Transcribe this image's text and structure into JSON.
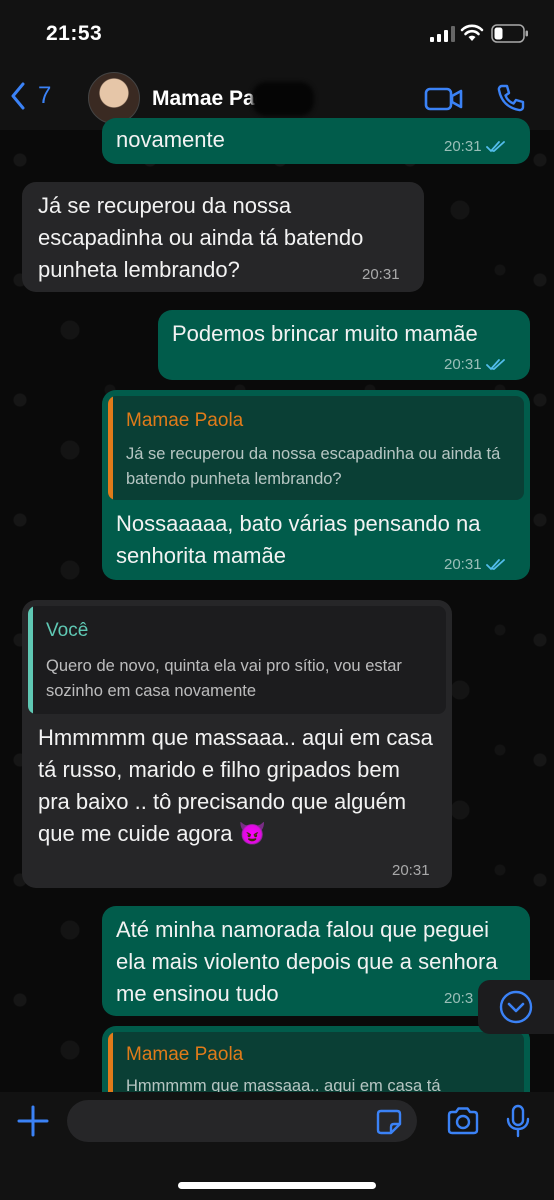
{
  "status_bar": {
    "time": "21:53"
  },
  "header": {
    "back_count": "7",
    "contact_name": "Mamae Paola"
  },
  "messages": [
    {
      "text": "novamente",
      "time": "20:31"
    },
    {
      "text": "Já se recuperou da nossa escapadinha ou ainda tá batendo punheta lembrando?",
      "time": "20:31"
    },
    {
      "text": "Podemos brincar muito mamãe",
      "time": "20:31"
    },
    {
      "quote_author": "Mamae Paola",
      "quote_text": "Já se recuperou da nossa escapadinha ou ainda tá batendo punheta lembrando?",
      "text": "Nossaaaaa, bato várias pensando na senhorita mamãe",
      "time": "20:31"
    },
    {
      "quote_author": "Você",
      "quote_text": "Quero de novo, quinta ela vai pro sítio, vou estar sozinho em casa novamente",
      "text": "Hmmmmm que massaaa..  aqui em casa tá russo, marido e filho gripados bem pra baixo .. tô precisando que alguém que me cuide agora 😈",
      "time": "20:31"
    },
    {
      "text": "Até minha namorada falou que peguei ela mais violento depois que a senhora me ensinou tudo",
      "time": "20:3"
    },
    {
      "quote_author": "Mamae Paola",
      "quote_text": "Hmmmmm que massaaa..  aqui em casa tá"
    }
  ],
  "input": {
    "placeholder": ""
  },
  "colors": {
    "outgoing_bubble": "#015c4b",
    "incoming_bubble": "#262628",
    "accent_blue": "#3b82f6",
    "quote_orange": "#e07b1a",
    "quote_teal": "#5fc8b4"
  },
  "icons": [
    "chevron-left-icon",
    "video-camera-icon",
    "phone-icon",
    "double-check-icon",
    "chevron-down-icon",
    "plus-icon",
    "sticker-icon",
    "camera-icon",
    "microphone-icon",
    "signal-icon",
    "wifi-icon",
    "battery-icon"
  ]
}
